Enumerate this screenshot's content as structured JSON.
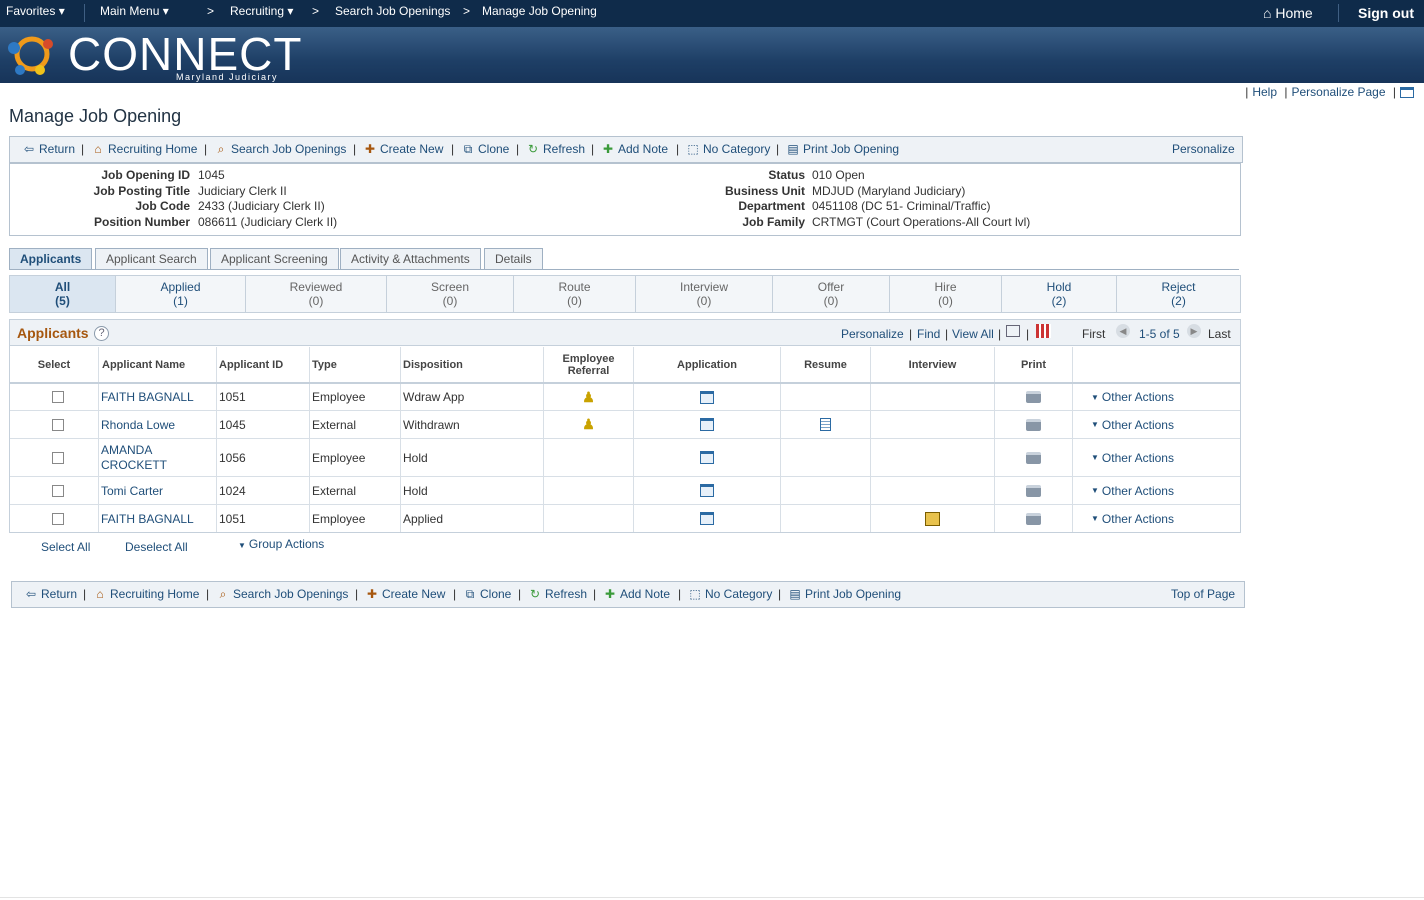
{
  "topbar": {
    "favorites": "Favorites",
    "main_menu": "Main Menu",
    "breadcrumbs": [
      "Recruiting",
      "Search Job Openings",
      "Manage Job Opening"
    ],
    "home": "Home",
    "sign_out": "Sign out"
  },
  "banner": {
    "logo": "CONNECT",
    "sub": "Maryland Judiciary"
  },
  "header_links": {
    "help": "Help",
    "personalize_page": "Personalize Page"
  },
  "page_title": "Manage Job Opening",
  "toolbar": {
    "return": "Return",
    "recruiting_home": "Recruiting Home",
    "search_job_openings": "Search Job Openings",
    "create_new": "Create New",
    "clone": "Clone",
    "refresh": "Refresh",
    "add_note": "Add Note",
    "no_category": "No Category",
    "print_job_opening": "Print Job Opening",
    "personalize": "Personalize",
    "top_of_page": "Top of Page"
  },
  "info": {
    "job_opening_id_label": "Job Opening ID",
    "job_opening_id": "1045",
    "job_posting_title_label": "Job Posting Title",
    "job_posting_title": "Judiciary Clerk II",
    "job_code_label": "Job Code",
    "job_code": "2433 (Judiciary Clerk II)",
    "position_number_label": "Position Number",
    "position_number": "086611 (Judiciary Clerk II)",
    "status_label": "Status",
    "status": "010 Open",
    "business_unit_label": "Business Unit",
    "business_unit": "MDJUD (Maryland Judiciary)",
    "department_label": "Department",
    "department": "0451108 (DC 51- Criminal/Traffic)",
    "job_family_label": "Job Family",
    "job_family": "CRTMGT (Court Operations-All Court lvl)"
  },
  "tabs": [
    "Applicants",
    "Applicant Search",
    "Applicant Screening",
    "Activity & Attachments",
    "Details"
  ],
  "status_filters": [
    {
      "label": "All",
      "count": "(5)"
    },
    {
      "label": "Applied",
      "count": "(1)"
    },
    {
      "label": "Reviewed",
      "count": "(0)"
    },
    {
      "label": "Screen",
      "count": "(0)"
    },
    {
      "label": "Route",
      "count": "(0)"
    },
    {
      "label": "Interview",
      "count": "(0)"
    },
    {
      "label": "Offer",
      "count": "(0)"
    },
    {
      "label": "Hire",
      "count": "(0)"
    },
    {
      "label": "Hold",
      "count": "(2)"
    },
    {
      "label": "Reject",
      "count": "(2)"
    }
  ],
  "grid": {
    "title": "Applicants",
    "help": "?",
    "personalize": "Personalize",
    "find": "Find",
    "view_all": "View All",
    "first": "First",
    "range": "1-5 of 5",
    "last": "Last",
    "columns": [
      "Select",
      "Applicant Name",
      "Applicant ID",
      "Type",
      "Disposition",
      "Employee Referral",
      "Application",
      "Resume",
      "Interview",
      "Print",
      ""
    ],
    "rows": [
      {
        "name": "FAITH BAGNALL",
        "id": "1051",
        "type": "Employee",
        "disposition": "Wdraw App",
        "referral": true,
        "resume": false,
        "interview": false,
        "other": "Other Actions"
      },
      {
        "name": "Rhonda Lowe",
        "id": "1045",
        "type": "External",
        "disposition": "Withdrawn",
        "referral": true,
        "resume": true,
        "interview": false,
        "other": "Other Actions"
      },
      {
        "name": "AMANDA CROCKETT",
        "id": "1056",
        "type": "Employee",
        "disposition": "Hold",
        "referral": false,
        "resume": false,
        "interview": false,
        "other": "Other Actions"
      },
      {
        "name": "Tomi Carter",
        "id": "1024",
        "type": "External",
        "disposition": "Hold",
        "referral": false,
        "resume": false,
        "interview": false,
        "other": "Other Actions"
      },
      {
        "name": "FAITH BAGNALL",
        "id": "1051",
        "type": "Employee",
        "disposition": "Applied",
        "referral": false,
        "resume": false,
        "interview": true,
        "other": "Other Actions"
      }
    ]
  },
  "select_all": "Select All",
  "deselect_all": "Deselect All",
  "group_actions": "Group Actions"
}
